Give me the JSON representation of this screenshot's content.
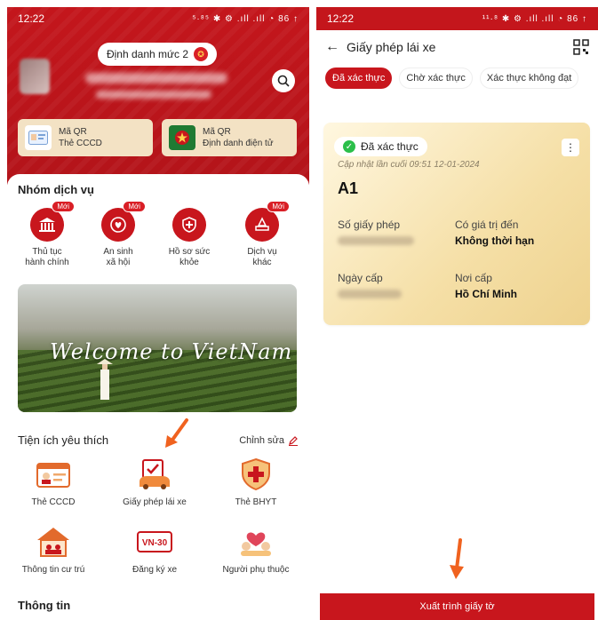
{
  "left": {
    "status": {
      "time": "12:22",
      "icons": "⁵·⁸⁵ ✱ ⚙ .ıll .ıll ◔ 86 ↑"
    },
    "id_level": "Định danh mức 2",
    "qr_cards": [
      {
        "line1": "Mã QR",
        "line2": "Thẻ CCCD",
        "icon": "id-card-icon"
      },
      {
        "line1": "Mã QR",
        "line2": "Định danh điện tử",
        "icon": "emblem-icon"
      }
    ],
    "services_title": "Nhóm dịch vụ",
    "services": [
      {
        "label": "Thủ tục\nhành chính",
        "badge": "Mới",
        "icon": "building-icon"
      },
      {
        "label": "An sinh\nxã hội",
        "badge": "Mới",
        "icon": "social-security-icon"
      },
      {
        "label": "Hồ sơ sức\nkhỏe",
        "badge": "",
        "icon": "health-shield-icon"
      },
      {
        "label": "Dịch vụ\nkhác",
        "badge": "Mới",
        "icon": "other-services-icon"
      }
    ],
    "banner_text": "Welcome to VietNam",
    "favorites_title": "Tiện ích yêu thích",
    "edit_label": "Chỉnh sửa",
    "favorites": [
      {
        "label": "Thẻ CCCD",
        "icon": "id-card-icon"
      },
      {
        "label": "Giấy phép lái xe",
        "icon": "driver-license-icon"
      },
      {
        "label": "Thẻ BHYT",
        "icon": "health-insurance-icon"
      },
      {
        "label": "Thông tin cư trú",
        "icon": "residence-icon"
      },
      {
        "label": "Đăng ký xe",
        "icon": "vehicle-plate-icon"
      },
      {
        "label": "Người phụ thuộc",
        "icon": "dependents-icon"
      }
    ],
    "plate_text": "VN-30",
    "info_title": "Thông tin"
  },
  "right": {
    "status": {
      "time": "12:22",
      "icons": "¹¹·⁸ ✱ ⚙ .ıll .ıll ◔ 86 ↑"
    },
    "title": "Giấy phép lái xe",
    "tabs": [
      "Đã xác thực",
      "Chờ xác thực",
      "Xác thực không đạt"
    ],
    "card": {
      "status": "Đã xác thực",
      "updated": "Cập nhật lần cuối 09:51 12-01-2024",
      "class": "A1",
      "license_no_label": "Số giấy phép",
      "valid_until_label": "Có giá trị đến",
      "valid_until_value": "Không thời hạn",
      "issue_date_label": "Ngày cấp",
      "issue_place_label": "Nơi cấp",
      "issue_place_value": "Hồ Chí Minh"
    },
    "present_button": "Xuất trình giấy tờ"
  }
}
